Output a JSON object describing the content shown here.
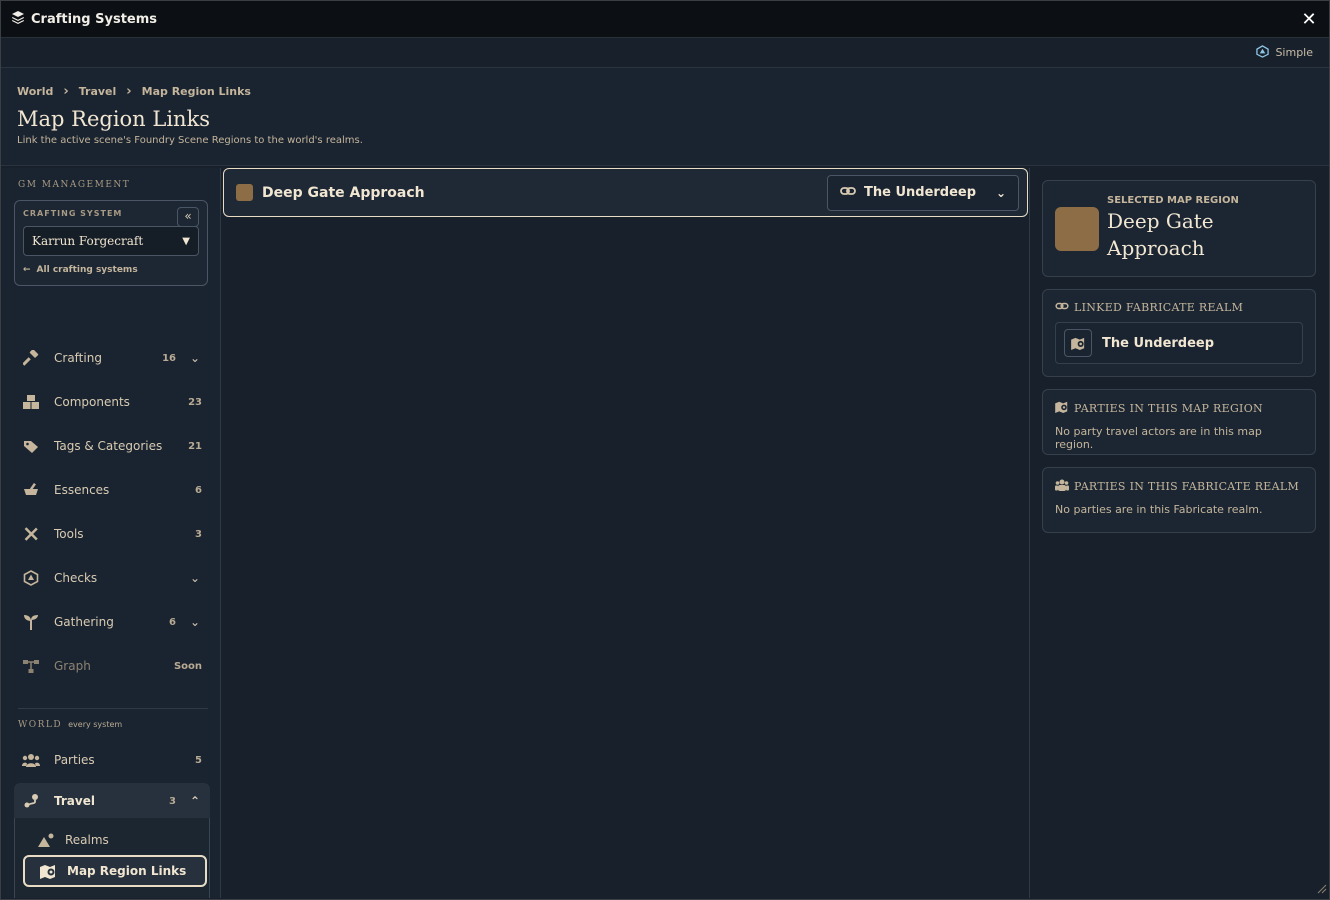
{
  "window": {
    "title": "Crafting Systems"
  },
  "modebar": {
    "mode_label": "Simple"
  },
  "header": {
    "breadcrumb": [
      "World",
      "Travel",
      "Map Region Links"
    ],
    "title": "Map Region Links",
    "subtitle": "Link the active scene's Foundry Scene Regions to the world's realms."
  },
  "sidebar": {
    "gm_label": "GM MANAGEMENT",
    "crafting_system": {
      "label": "CRAFTING SYSTEM",
      "selected": "Karrun Forgecraft",
      "all_link": "All crafting systems"
    },
    "items": [
      {
        "label": "Crafting",
        "count": "16",
        "icon": "hammer-icon"
      },
      {
        "label": "Components",
        "count": "23",
        "icon": "boxes-icon"
      },
      {
        "label": "Tags & Categories",
        "count": "21",
        "icon": "tags-icon"
      },
      {
        "label": "Essences",
        "count": "6",
        "icon": "mortar-icon"
      },
      {
        "label": "Tools",
        "count": "3",
        "icon": "tools-icon"
      },
      {
        "label": "Checks",
        "count": "",
        "icon": "dice-icon"
      },
      {
        "label": "Gathering",
        "count": "6",
        "icon": "seedling-icon"
      },
      {
        "label": "Graph",
        "count": "Soon",
        "icon": "graph-icon"
      }
    ],
    "world_label": "WORLD",
    "world_sub": "every system",
    "world_items": [
      {
        "label": "Parties",
        "count": "5",
        "icon": "users-icon"
      },
      {
        "label": "Travel",
        "count": "3",
        "icon": "route-icon"
      }
    ],
    "travel_sub": [
      {
        "label": "Realms",
        "icon": "mountain-sun-icon"
      },
      {
        "label": "Map Region Links",
        "icon": "map-location-icon"
      }
    ]
  },
  "main": {
    "region": {
      "name": "Deep Gate Approach",
      "color": "#8c6d45",
      "linked_realm": "The Underdeep"
    }
  },
  "details": {
    "selected_label": "SELECTED MAP REGION",
    "selected_name": "Deep Gate Approach",
    "linked_title": "LINKED FABRICATE REALM",
    "linked_realm": "The Underdeep",
    "parties_region_title": "PARTIES IN THIS MAP REGION",
    "parties_region_text": "No party travel actors are in this map region.",
    "parties_realm_title": "PARTIES IN THIS FABRICATE REALM",
    "parties_realm_text": "No parties are in this Fabricate realm."
  },
  "colors": {
    "accent": "#d9cbb3",
    "swatch": "#8c6d45",
    "background": "#18212b"
  }
}
